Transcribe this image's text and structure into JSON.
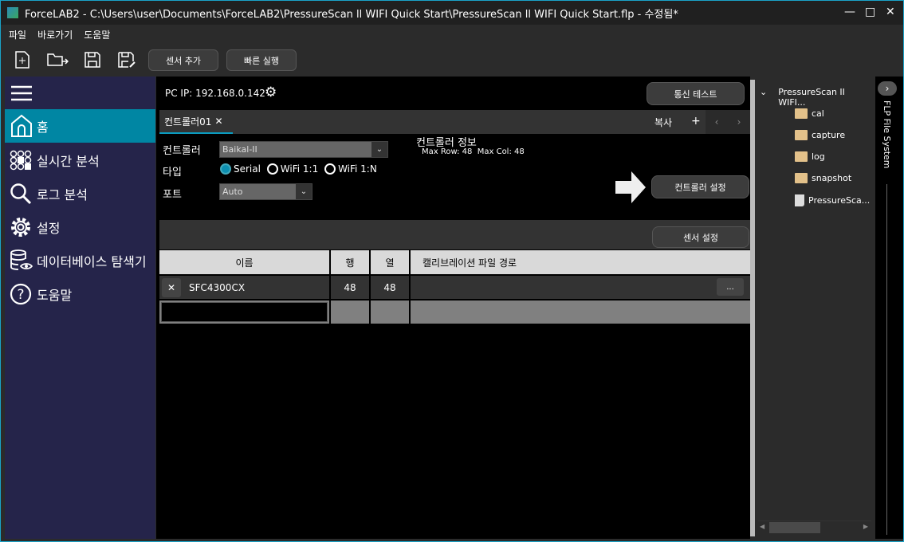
{
  "window": {
    "title": "ForceLAB2 - C:\\Users\\user\\Documents\\ForceLAB2\\PressureScan ll WIFI Quick Start\\PressureScan ll WIFI Quick Start.flp - 수정됨*"
  },
  "menu": [
    "파일",
    "바로가기",
    "도움말"
  ],
  "toolbar": {
    "add_sensor": "센서 추가",
    "quick_run": "빠른 실행"
  },
  "sidebar": {
    "items": [
      {
        "label": "홈",
        "icon": "home-icon"
      },
      {
        "label": "실시간 분석",
        "icon": "grid-icon"
      },
      {
        "label": "로그 분석",
        "icon": "search-icon"
      },
      {
        "label": "설정",
        "icon": "gear-icon"
      },
      {
        "label": "데이터베이스 탐색기",
        "icon": "database-icon"
      },
      {
        "label": "도움말",
        "icon": "help-icon"
      }
    ]
  },
  "main": {
    "pc_ip": "PC IP: 192.168.0.142",
    "comm_test": "통신 테스트",
    "tab": "컨트롤러01",
    "copy": "복사",
    "plus": "+",
    "controller_label": "컨트롤러",
    "controller_value": "Baikal-II",
    "type_label": "타입",
    "types": [
      "Serial",
      "WiFi 1:1",
      "WiFi 1:N"
    ],
    "port_label": "포트",
    "port_value": "Auto",
    "info_title": "컨트롤러 정보",
    "info_text": "Max Row: 48  Max Col: 48",
    "controller_settings": "컨트롤러 설정",
    "sensor_settings": "센서 설정",
    "table": {
      "headers": [
        "이름",
        "행",
        "열",
        "캘리브레이션 파일 경로"
      ],
      "rows": [
        {
          "name": "SFC4300CX",
          "row": "48",
          "col": "48",
          "path_btn": "..."
        }
      ]
    }
  },
  "tree": {
    "root": "PressureScan II WIFI...",
    "items": [
      "cal",
      "capture",
      "log",
      "snapshot"
    ],
    "file": "PressureSca...",
    "panel_label": "FLP File System"
  }
}
